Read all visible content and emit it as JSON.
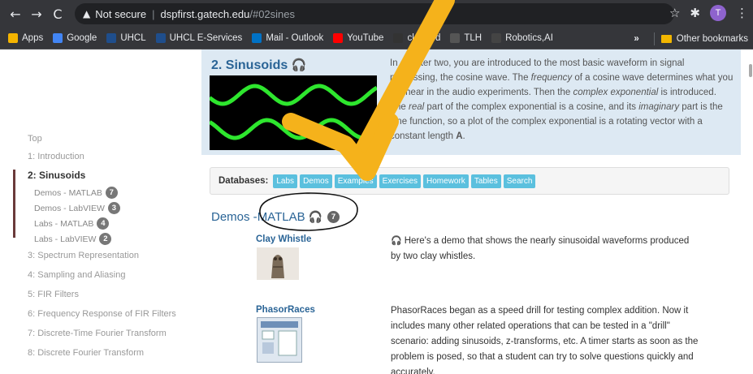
{
  "browser": {
    "nav": {
      "back": "←",
      "forward": "→",
      "reload": "C"
    },
    "security_label": "Not secure",
    "url_host": "dspfirst.gatech.edu",
    "url_path": "/#02sines",
    "avatar_letter": "T",
    "bookmarks": [
      {
        "label": "Apps",
        "icon": "apps-grid-icon",
        "color": "#f4b400"
      },
      {
        "label": "Google",
        "icon": "google-icon",
        "color": "#4285f4"
      },
      {
        "label": "UHCL",
        "icon": "uhcl-icon",
        "color": "#1f4e8c"
      },
      {
        "label": "UHCL E-Services",
        "icon": "uhcl-icon",
        "color": "#1f4e8c"
      },
      {
        "label": "Mail - Outlook",
        "icon": "outlook-icon",
        "color": "#0072c6"
      },
      {
        "label": "YouTube",
        "icon": "youtube-icon",
        "color": "#ff0000"
      },
      {
        "label": "ckboard",
        "icon": "blackboard-icon",
        "color": "#333333"
      },
      {
        "label": "TLH",
        "icon": "tlh-icon",
        "color": "#555555"
      },
      {
        "label": "Robotics,AI",
        "icon": "robotics-icon",
        "color": "#444444"
      }
    ],
    "more_bookmarks": "»",
    "other_bookmarks": "Other bookmarks"
  },
  "sidebar": {
    "items": [
      {
        "label": "Top",
        "active": false
      },
      {
        "label": "1: Introduction",
        "active": false
      },
      {
        "label": "2: Sinusoids",
        "active": true
      },
      {
        "label": "3: Spectrum Representation",
        "active": false
      },
      {
        "label": "4: Sampling and Aliasing",
        "active": false
      },
      {
        "label": "5: FIR Filters",
        "active": false
      },
      {
        "label": "6: Frequency Response of FIR Filters",
        "active": false
      },
      {
        "label": "7: Discrete-Time Fourier Transform",
        "active": false
      },
      {
        "label": "8: Discrete Fourier Transform",
        "active": false
      }
    ],
    "subitems": [
      {
        "label": "Demos - MATLAB",
        "count": "7"
      },
      {
        "label": "Demos - LabVIEW",
        "count": "3"
      },
      {
        "label": "Labs - MATLAB",
        "count": "4"
      },
      {
        "label": "Labs - LabVIEW",
        "count": "2"
      }
    ]
  },
  "chapter": {
    "title": "2. Sinusoids",
    "headphone": "🎧",
    "intro_parts": {
      "a": "In chapter two, you are introduced to the most basic waveform in signal processing, the cosine wave. The ",
      "b": "frequency",
      "c": " of a cosine wave determines what you will hear in the audio experiments. Then the ",
      "d": "complex exponential",
      "e": " is introduced. The ",
      "f": "real",
      "g": " part of the complex exponential is a cosine, and its ",
      "h": "imaginary",
      "i": " part is the sine function, so a plot of the complex exponential is a rotating vector with a constant length ",
      "j": "A",
      "k": "."
    }
  },
  "databases": {
    "label": "Databases:",
    "buttons": [
      "Labs",
      "Demos",
      "Examples",
      "Exercises",
      "Homework",
      "Tables",
      "Search"
    ]
  },
  "demos_section": {
    "prefix": "Demos - ",
    "highlight": "MATLAB",
    "count": "7",
    "items": [
      {
        "title": "Clay Whistle",
        "description": "Here's a demo that shows the nearly sinusoidal waveforms produced by two clay whistles."
      },
      {
        "title": "PhasorRaces",
        "description": "PhasorRaces began as a speed drill for testing complex addition. Now it includes many other related operations that can be tested in a \"drill\" scenario: adding sinusoids, z-transforms, etc. A timer starts as soon as the problem is posed, so that a student can try to solve questions quickly and accurately."
      }
    ]
  },
  "colors": {
    "link": "#2a6496",
    "db_button": "#5bc0de",
    "hero_bg": "#dde9f3",
    "annotation_arrow": "#f5b21b",
    "wave": "#2ee62e"
  }
}
